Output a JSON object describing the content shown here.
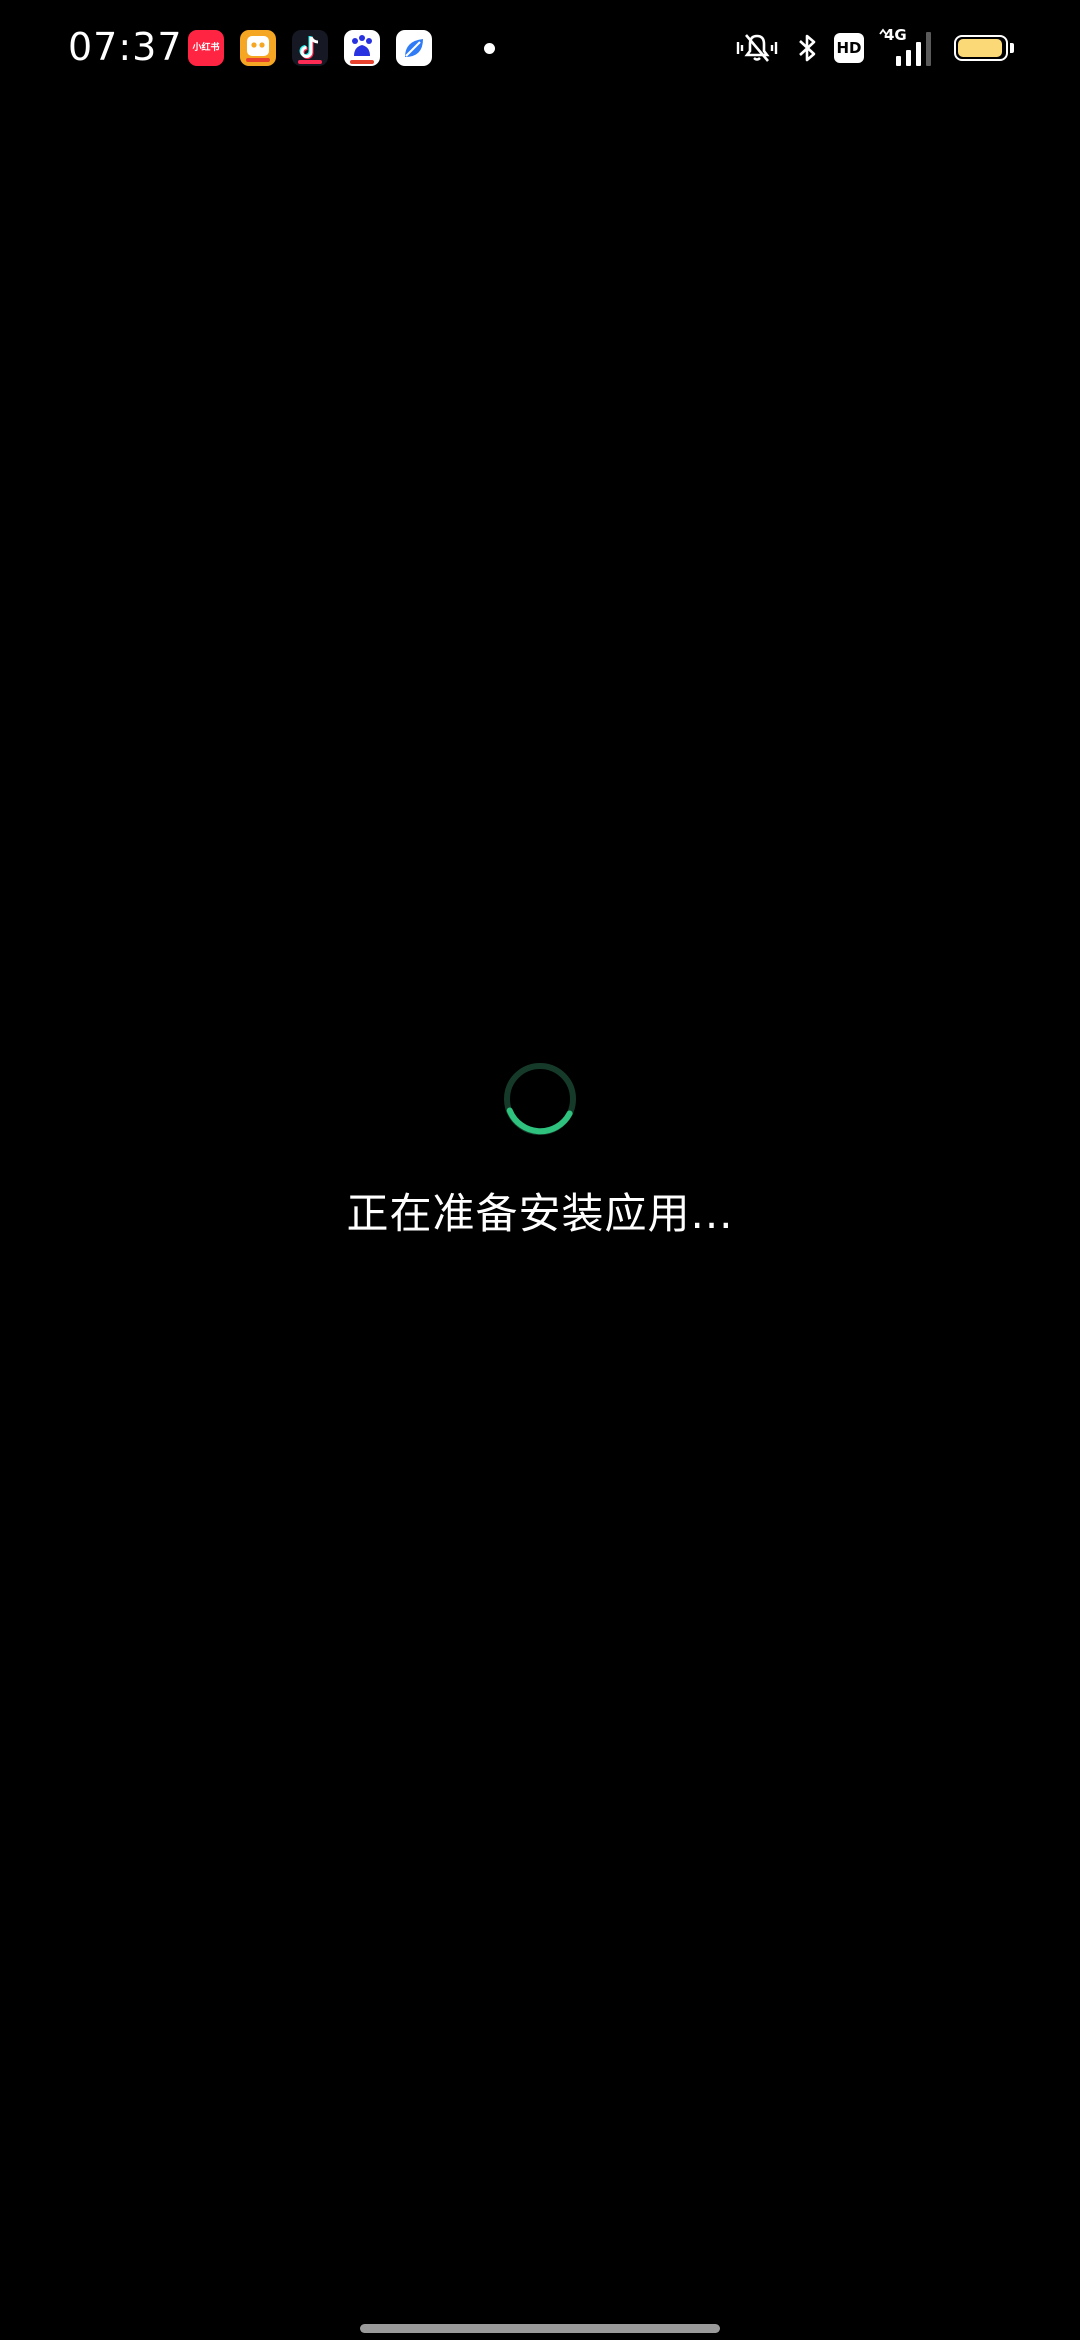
{
  "status_bar": {
    "time": "07:37",
    "notification_apps": [
      {
        "icon": "xiaohongshu-app-icon",
        "label": "小红书",
        "color": "#ff2442"
      },
      {
        "icon": "toutiao-app-icon",
        "color": "#f5a623"
      },
      {
        "icon": "douyin-app-icon",
        "color": "#161823"
      },
      {
        "icon": "baidu-app-icon",
        "color": "#ffffff"
      },
      {
        "icon": "leaf-app-icon",
        "color": "#ffffff"
      }
    ],
    "more_notifications": "more-dot-icon",
    "system_icons": [
      "vibrate-mute-icon",
      "bluetooth-icon",
      "hd-icon",
      "signal-4g-icon",
      "battery-icon"
    ],
    "hd_label": "HD",
    "network_type": "4G",
    "battery_fill_fraction": 0.95,
    "battery_color": "#fcd977"
  },
  "main": {
    "loading_text": "正在准备安装应用...",
    "spinner_track_color": "#163a2a",
    "spinner_arc_color": "#2ec27e"
  }
}
